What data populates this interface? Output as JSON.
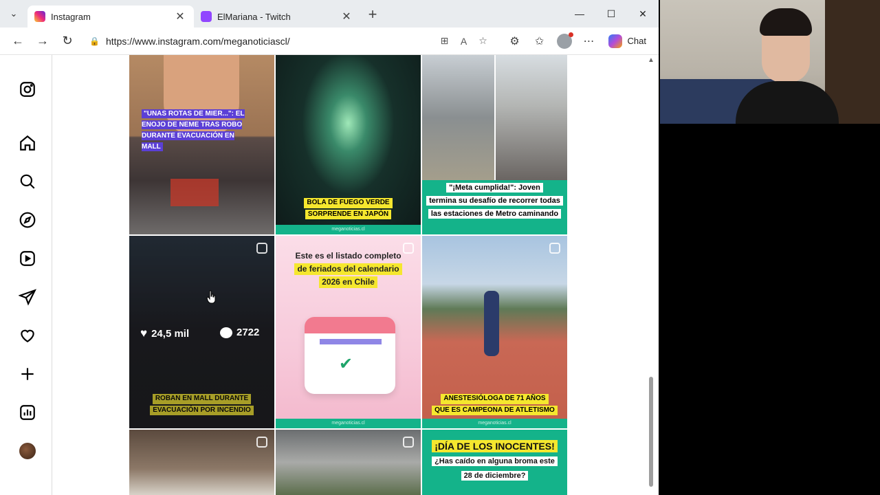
{
  "browser": {
    "tabs": [
      {
        "title": "Instagram",
        "active": true,
        "icon": "instagram-icon"
      },
      {
        "title": "ElMariana - Twitch",
        "active": false,
        "icon": "twitch-icon"
      }
    ],
    "url": "https://www.instagram.com/meganoticiascl/",
    "chat_label": "Chat"
  },
  "posts": {
    "p1_caption": "\"UNAS ROTAS DE MIER...\": EL ENOJO DE NEME TRAS ROBO DURANTE EVACUACIÓN EN MALL",
    "p2_line1": "BOLA DE FUEGO VERDE",
    "p2_line2": "SORPRENDE EN JAPÓN",
    "p3_line1": "\"¡Meta cumplida!\": Joven",
    "p3_line2": "termina su desafío de recorrer todas",
    "p3_line3": "las estaciones de Metro caminando",
    "p4_likes": "24,5 mil",
    "p4_comments": "2722",
    "p4_line1": "ROBAN EN MALL DURANTE",
    "p4_line2": "EVACUACIÓN POR INCENDIO",
    "p5_line1": "Este es el listado completo",
    "p5_line2": "de feriados del calendario",
    "p5_line3": "2026 en Chile",
    "p6_line1": "ANESTESIÓLOGA DE 71 AÑOS",
    "p6_line2": "QUE ES CAMPEONA DE ATLETISMO",
    "p9_line1": "¡DÍA DE LOS INOCENTES!",
    "p9_line2": "¿Has caído en alguna broma este",
    "p9_line3": "28 de diciembre?",
    "brand": "meganoticias.cl"
  },
  "colors": {
    "accent_green": "#14b38a",
    "highlight_yellow": "#f5e72e",
    "caption_purple": "#5b3fd6"
  }
}
